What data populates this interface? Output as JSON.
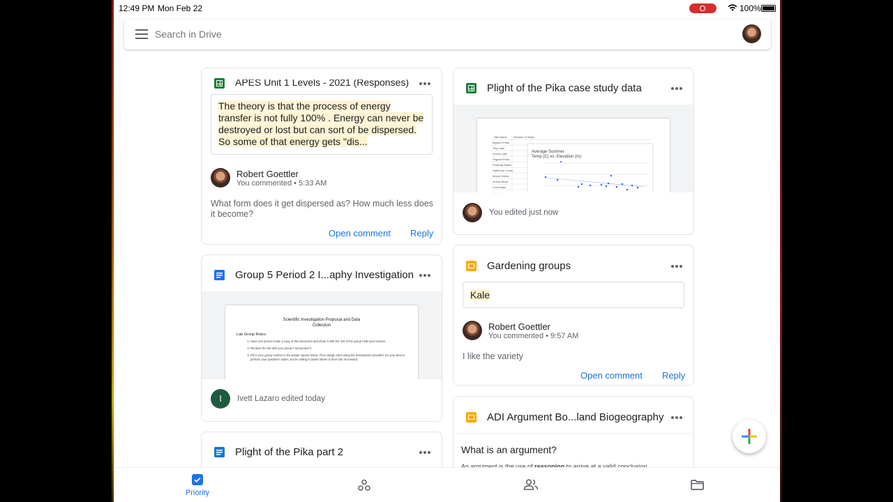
{
  "status_bar": {
    "time": "12:49 PM",
    "date": "Mon Feb 22",
    "battery": "100%"
  },
  "search": {
    "placeholder": "Search in Drive"
  },
  "cards": {
    "responses": {
      "title": "APES Unit 1 Levels - 2021 (Responses)",
      "quote": "The theory is that the process of energy transfer is not fully 100% . Energy can never be destroyed or lost but can sort of be dispersed.  So some of that energy gets \"dis...",
      "author": "Robert Goettler",
      "meta": "You commented • 5:33 AM",
      "comment": "What form does it get dispersed as? How much less does it become?",
      "open_label": "Open comment",
      "reply_label": "Reply"
    },
    "pika_data": {
      "title": "Plight of the Pika case study data",
      "activity": "You edited just now",
      "chart_title": "Average Summer Temp (C) vs. Elevation (m)"
    },
    "group5": {
      "title": "Group 5 Period 2 I...aphy Investigation",
      "doc_title": "Scientific Investigation Proposal and Data Collection",
      "doc_heading": "Lab Group Roles:",
      "doc_items": [
        "Have one person make a copy of this document and share it with the rest of the group AND your teacher.",
        "Rename the file with your group # and period #.",
        "Fill in your group number in the purple square below. Then assign roles using the descriptions provided. Do your best to perform your position's duties, but be willing to assist others in their role as needed."
      ],
      "avatar_letter": "I",
      "activity": "Ivett Lazaro edited today"
    },
    "gardening": {
      "title": "Gardening groups",
      "quote": "Kale",
      "author": "Robert Goettler",
      "meta": "You commented • 9:57 AM",
      "comment": "I like the variety",
      "open_label": "Open comment",
      "reply_label": "Reply"
    },
    "pika2": {
      "title": "Plight of the Pika part 2"
    },
    "adi": {
      "title": "ADI Argument Bo...land Biogeography",
      "heading": "What is an argument?",
      "body_start": "An argument is the use of ",
      "body_bold": "reasoning",
      "body_end": " to arrive at a valid conclusion"
    }
  },
  "bottom_nav": {
    "priority_label": "Priority"
  },
  "colors": {
    "accent": "#1a73e8",
    "sheets": "#188038",
    "slides": "#f9ab00",
    "highlight": "#fdf3d3"
  },
  "icons": [
    "menu-icon",
    "wifi-icon",
    "battery-icon",
    "sheets-icon",
    "docs-icon",
    "slides-icon",
    "more-icon",
    "priority-icon",
    "shared-drives-icon",
    "shared-icon",
    "folder-icon",
    "plus-icon"
  ]
}
